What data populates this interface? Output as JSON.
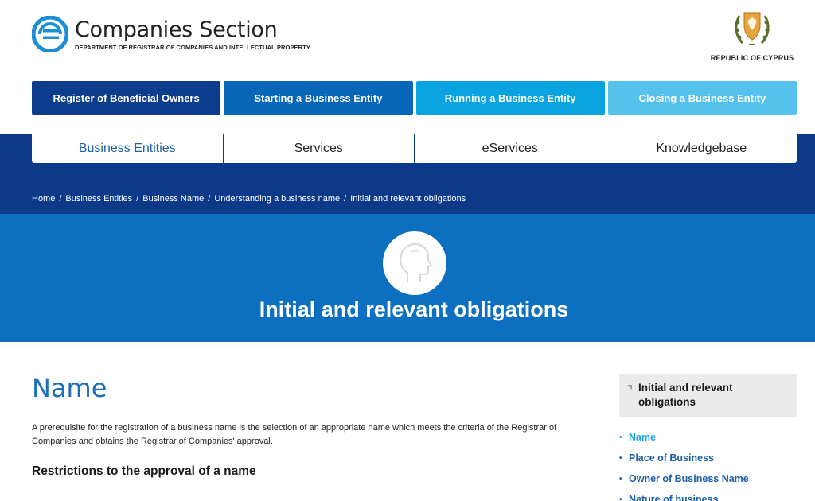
{
  "header": {
    "logo_title": "Companies Section",
    "logo_subtitle": "DEPARTMENT OF REGISTRAR OF COMPANIES AND INTELLECTUAL PROPERTY",
    "coat_of_arms_label": "REPUBLIC OF CYPRUS"
  },
  "sections": [
    {
      "label": "Register of Beneficial Owners",
      "color": "#0b3d8c"
    },
    {
      "label": "Starting a Business Entity",
      "color": "#0866b8"
    },
    {
      "label": "Running a Business Entity",
      "color": "#09a3e0"
    },
    {
      "label": "Closing a Business Entity",
      "color": "#55c2ee"
    }
  ],
  "nav_tabs": [
    {
      "label": "Business Entities",
      "active": true
    },
    {
      "label": "Services",
      "active": false
    },
    {
      "label": "eServices",
      "active": false
    },
    {
      "label": "Knowledgebase",
      "active": false
    }
  ],
  "breadcrumb": [
    "Home",
    "Business Entities",
    "Business Name",
    "Understanding a business name",
    "Initial and relevant obligations"
  ],
  "hero": {
    "icon": "head-profile-icon",
    "title": "Initial and relevant obligations"
  },
  "main": {
    "heading": "Name",
    "paragraph": "A prerequisite for the registration of a business name is the selection of an appropriate name which meets the criteria of the Registrar of Companies and obtains the Registrar of Companies' approval.",
    "subheading": "Restrictions to the approval of a name"
  },
  "sidebar": {
    "title": "Initial and relevant obligations",
    "items": [
      {
        "label": "Name",
        "current": true
      },
      {
        "label": "Place of Business",
        "current": false
      },
      {
        "label": "Owner of Business Name",
        "current": false
      },
      {
        "label": "Nature of business",
        "current": false
      }
    ]
  },
  "colors": {
    "dark_band": "#0c3a89",
    "hero": "#0c6fbf",
    "heading_blue": "#1c6fb8",
    "link_blue": "#1c5fa8",
    "current_link": "#1aa0e6"
  }
}
